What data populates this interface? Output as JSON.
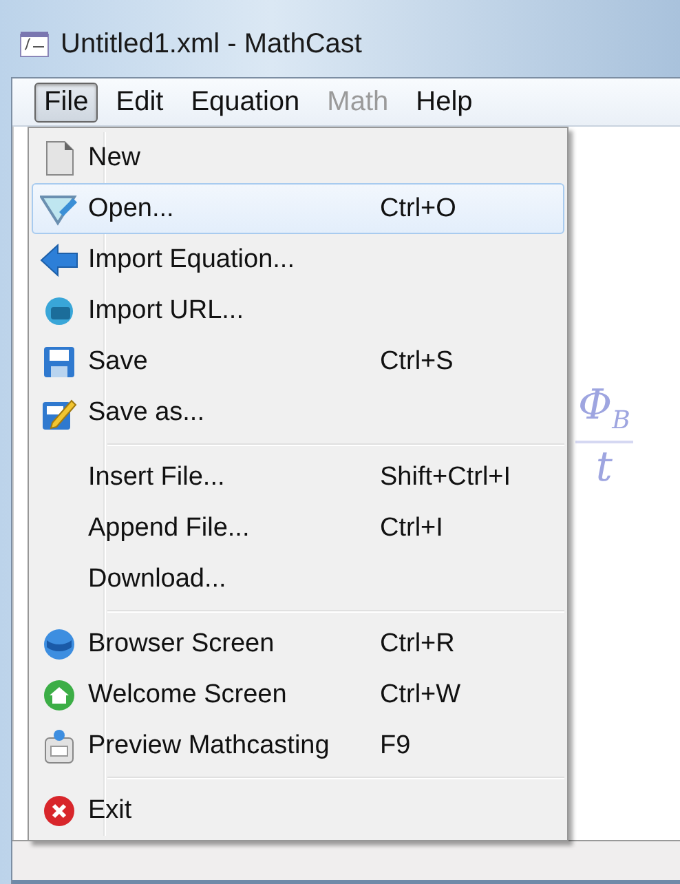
{
  "window": {
    "title": "Untitled1.xml - MathCast"
  },
  "menu_bar": [
    {
      "label": "File",
      "selected": true,
      "disabled": false
    },
    {
      "label": "Edit",
      "selected": false,
      "disabled": false
    },
    {
      "label": "Equation",
      "selected": false,
      "disabled": false
    },
    {
      "label": "Math",
      "selected": false,
      "disabled": true
    },
    {
      "label": "Help",
      "selected": false,
      "disabled": false
    }
  ],
  "equation": {
    "numerator": "Φ$_{B}$",
    "denominator": "t"
  },
  "file_menu": [
    {
      "kind": "item",
      "label": "New",
      "selected": false
    },
    {
      "kind": "item",
      "label": "Open...",
      "shortcut": "Ctrl+O",
      "selected": true
    },
    {
      "kind": "item",
      "label": "Import Equation...",
      "selected": false
    },
    {
      "kind": "item",
      "label": "Import URL...",
      "selected": false
    },
    {
      "kind": "item",
      "label": "Save",
      "shortcut": "Ctrl+S",
      "selected": false
    },
    {
      "kind": "item",
      "label": "Save as...",
      "selected": false
    },
    {
      "kind": "separator"
    },
    {
      "kind": "item",
      "label": "Insert File...",
      "shortcut": "Shift+Ctrl+I",
      "selected": false
    },
    {
      "kind": "item",
      "label": "Append File...",
      "shortcut": "Ctrl+I",
      "selected": false
    },
    {
      "kind": "item",
      "label": "Download...",
      "selected": false
    },
    {
      "kind": "separator"
    },
    {
      "kind": "item",
      "label": "Browser Screen",
      "shortcut": "Ctrl+R",
      "selected": false
    },
    {
      "kind": "item",
      "label": "Welcome Screen",
      "shortcut": "Ctrl+W",
      "selected": false
    },
    {
      "kind": "item",
      "label": "Preview Mathcasting",
      "shortcut": "F9",
      "selected": false
    },
    {
      "kind": "separator"
    },
    {
      "kind": "item",
      "label": "Exit",
      "selected": false
    }
  ]
}
